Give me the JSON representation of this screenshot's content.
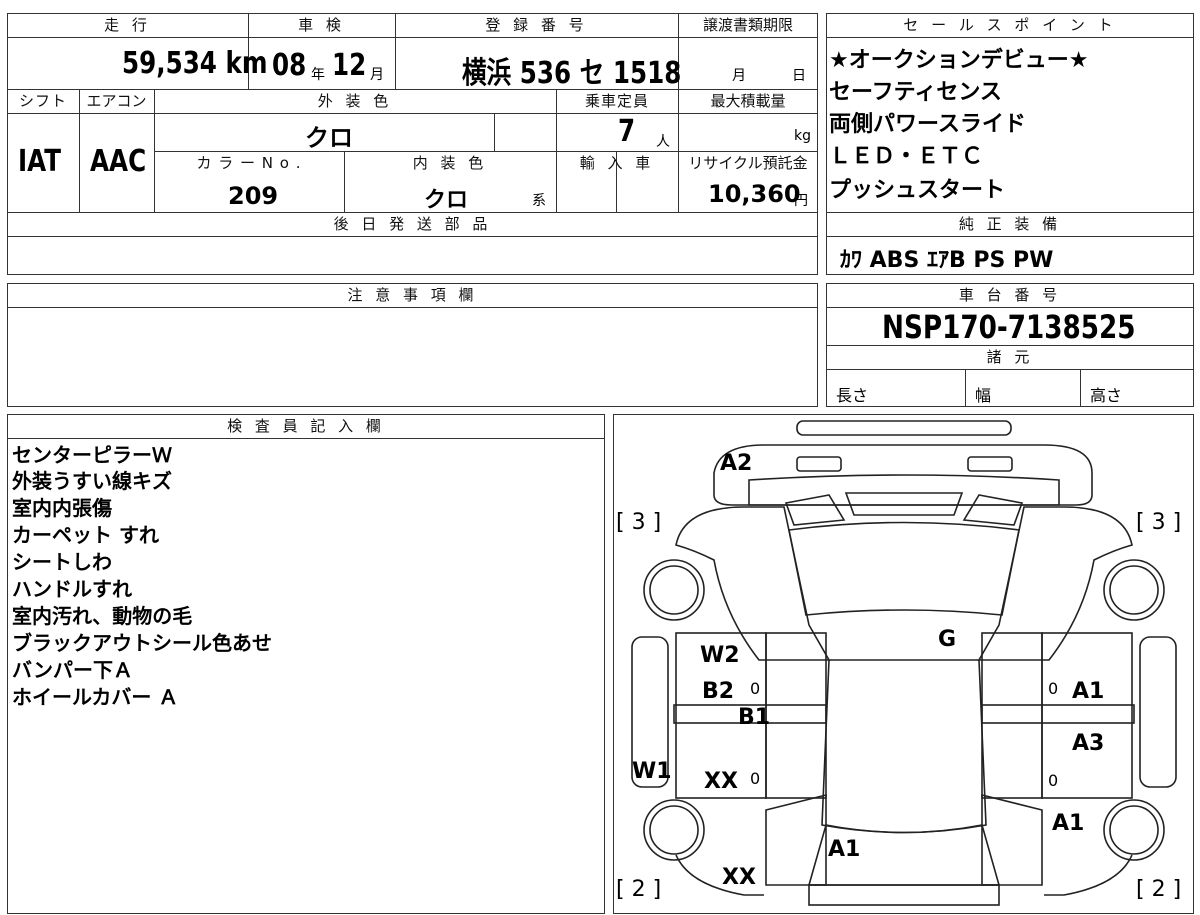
{
  "top_left": {
    "mileage_header": "走 行",
    "inspection_header": "車 検",
    "plate_header": "登 録 番 号",
    "transfer_header": "譲渡書類期限",
    "mileage": "59,534 km",
    "inspection_year": "08",
    "year_unit": "年",
    "inspection_month": "12",
    "month_unit": "月",
    "plate": "横浜 536 セ 1518",
    "transfer_month_unit": "月",
    "transfer_day_unit": "日",
    "shift_header": "シフト",
    "aircon_header": "エアコン",
    "exterior_header": "外 装 色",
    "capacity_header": "乗車定員",
    "load_header": "最大積載量",
    "shift": "IAT",
    "aircon": "AAC",
    "exterior_color": "クロ",
    "capacity": "7",
    "capacity_unit": "人",
    "load_unit": "kg",
    "color_no_header": "カ ラ ー N o .",
    "interior_header": "内 装 色",
    "import_header": "輸 入 車",
    "recycle_header": "リサイクル預託金",
    "color_no": "209",
    "interior_color": "クロ",
    "interior_suffix": "系",
    "recycle": "10,360",
    "yen_unit": "円",
    "later_parts_header": "後 日 発 送 部 品"
  },
  "sales": {
    "header": "セ ー ル ス ポ イ ン ト",
    "points": [
      "★オークションデビュー★",
      "セーフティセンス",
      "両側パワースライド",
      "ＬＥＤ・ＥＴＣ",
      "プッシュスタート"
    ],
    "equipment_header": "純 正 装 備",
    "equipment": "ｶﾜ ABS ｴｱB PS PW"
  },
  "notes": {
    "header": "注 意 事 項 欄"
  },
  "chassis": {
    "header": "車 台 番 号",
    "number": "NSP170-7138525",
    "specs_header": "諸 元",
    "length": "長さ",
    "width": "幅",
    "height": "高さ"
  },
  "inspector": {
    "header": "検 査 員 記 入 欄",
    "lines": [
      "センターピラーＷ",
      "外装うすい線キズ",
      "室内内張傷",
      "カーペット すれ",
      "シートしわ",
      "ハンドルすれ",
      "室内汚れ、動物の毛",
      "ブラックアウトシール色あせ",
      "バンパー下Ａ",
      "ホイールカバー Ａ"
    ]
  },
  "diagram": {
    "marks": {
      "a2": "A2",
      "g": "G",
      "w2": "W2",
      "b2": "B2",
      "b1": "B1",
      "w1": "W1",
      "xx_left": "XX",
      "xx_bottom": "XX",
      "a1_right_top": "A1",
      "a3": "A3",
      "a1_right_bottom": "A1",
      "a1_bottom": "A1"
    },
    "zeros": [
      "0",
      "0",
      "0",
      "0"
    ],
    "brackets": [
      "[ 3 ]",
      "[ 3 ]",
      "[ 2 ]",
      "[ 2 ]"
    ]
  }
}
